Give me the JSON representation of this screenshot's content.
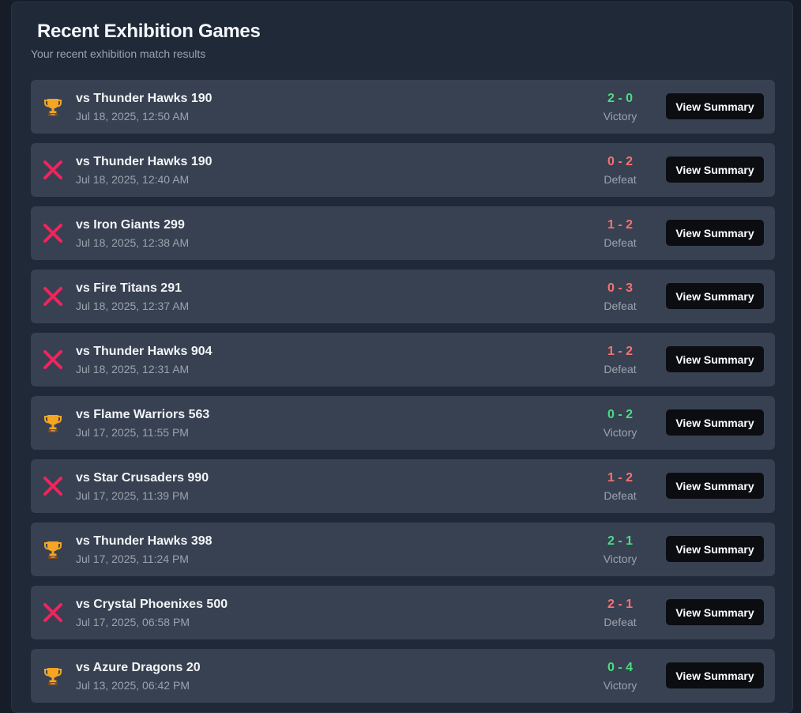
{
  "header": {
    "title": "Recent Exhibition Games",
    "subtitle": "Your recent exhibition match results"
  },
  "colors": {
    "victory": "#4ade80",
    "defeat": "#f87171",
    "trophy": "#f5a524",
    "loss_icon": "#f0245e"
  },
  "icons": {
    "victory": "trophy-icon",
    "defeat": "close-icon"
  },
  "button_label": "View Summary",
  "games": [
    {
      "opponent": "vs Thunder Hawks 190",
      "date": "Jul 18, 2025, 12:50 AM",
      "score": "2 - 0",
      "result": "Victory"
    },
    {
      "opponent": "vs Thunder Hawks 190",
      "date": "Jul 18, 2025, 12:40 AM",
      "score": "0 - 2",
      "result": "Defeat"
    },
    {
      "opponent": "vs Iron Giants 299",
      "date": "Jul 18, 2025, 12:38 AM",
      "score": "1 - 2",
      "result": "Defeat"
    },
    {
      "opponent": "vs Fire Titans 291",
      "date": "Jul 18, 2025, 12:37 AM",
      "score": "0 - 3",
      "result": "Defeat"
    },
    {
      "opponent": "vs Thunder Hawks 904",
      "date": "Jul 18, 2025, 12:31 AM",
      "score": "1 - 2",
      "result": "Defeat"
    },
    {
      "opponent": "vs Flame Warriors 563",
      "date": "Jul 17, 2025, 11:55 PM",
      "score": "0 - 2",
      "result": "Victory"
    },
    {
      "opponent": "vs Star Crusaders 990",
      "date": "Jul 17, 2025, 11:39 PM",
      "score": "1 - 2",
      "result": "Defeat"
    },
    {
      "opponent": "vs Thunder Hawks 398",
      "date": "Jul 17, 2025, 11:24 PM",
      "score": "2 - 1",
      "result": "Victory"
    },
    {
      "opponent": "vs Crystal Phoenixes 500",
      "date": "Jul 17, 2025, 06:58 PM",
      "score": "2 - 1",
      "result": "Defeat"
    },
    {
      "opponent": "vs Azure Dragons 20",
      "date": "Jul 13, 2025, 06:42 PM",
      "score": "0 - 4",
      "result": "Victory"
    }
  ]
}
